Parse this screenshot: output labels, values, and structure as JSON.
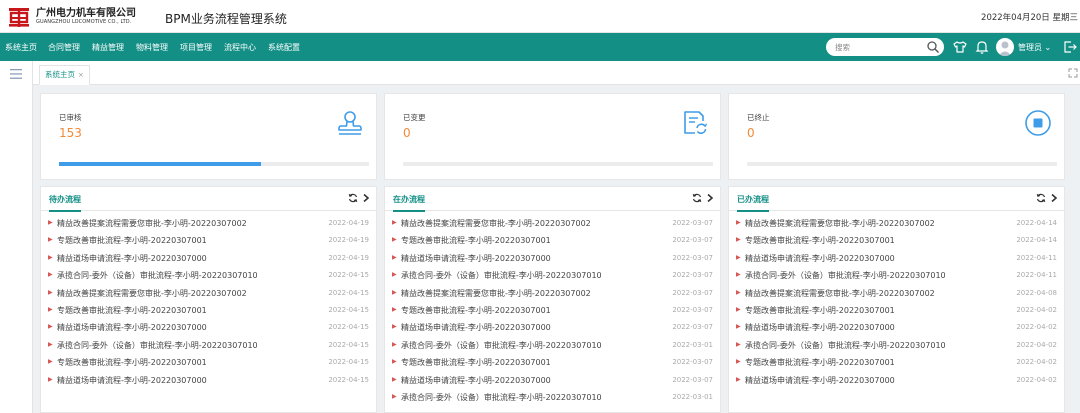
{
  "header": {
    "company_cn": "广州电力机车有限公司",
    "company_en": "GUANGZHOU LOCOMOTIVE CO., LTD.",
    "system_title": "BPM业务流程管理系统",
    "date": "2022年04月20日  星期三",
    "logo_color": "#c8161d"
  },
  "nav": {
    "items": [
      "系统主页",
      "合同管理",
      "精益管理",
      "物料管理",
      "项目管理",
      "流程中心",
      "系统配置"
    ],
    "search_placeholder": "搜索",
    "user_label": "管理员 ⌄",
    "bg_color": "#138f86"
  },
  "tabs": {
    "items": [
      {
        "label": "系统主页",
        "close": "×"
      }
    ]
  },
  "stats": [
    {
      "label": "已审核",
      "value": "153",
      "progress_fraction": 0.65,
      "icon": "stamp-icon"
    },
    {
      "label": "已变更",
      "value": "0",
      "progress_fraction": 0,
      "icon": "document-refresh-icon"
    },
    {
      "label": "已终止",
      "value": "0",
      "progress_fraction": 0,
      "icon": "stop-icon"
    }
  ],
  "panels": [
    {
      "title": "待办流程",
      "rows": [
        {
          "text": "精益改善提案流程需要您审批-李小明-20220307002",
          "date": "2022-04-19"
        },
        {
          "text": "专题改善审批流程-李小明-20220307001",
          "date": "2022-04-19"
        },
        {
          "text": "精益道场申请流程-李小明-20220307000",
          "date": "2022-04-19"
        },
        {
          "text": "承揽合同-委外（设备）审批流程-李小明-20220307010",
          "date": "2022-04-15"
        },
        {
          "text": "精益改善提案流程需要您审批-李小明-20220307002",
          "date": "2022-04-15"
        },
        {
          "text": "专题改善审批流程-李小明-20220307001",
          "date": "2022-04-15"
        },
        {
          "text": "精益道场申请流程-李小明-20220307000",
          "date": "2022-04-15"
        },
        {
          "text": "承揽合同-委外（设备）审批流程-李小明-20220307010",
          "date": "2022-04-15"
        },
        {
          "text": "专题改善审批流程-李小明-20220307001",
          "date": "2022-04-15"
        },
        {
          "text": "精益道场申请流程-李小明-20220307000",
          "date": "2022-04-15"
        }
      ]
    },
    {
      "title": "在办流程",
      "rows": [
        {
          "text": "精益改善提案流程需要您审批-李小明-20220307002",
          "date": "2022-03-07"
        },
        {
          "text": "专题改善审批流程-李小明-20220307001",
          "date": "2022-03-07"
        },
        {
          "text": "精益道场申请流程-李小明-20220307000",
          "date": "2022-03-07"
        },
        {
          "text": "承揽合同-委外（设备）审批流程-李小明-20220307010",
          "date": "2022-03-07"
        },
        {
          "text": "精益改善提案流程需要您审批-李小明-20220307002",
          "date": "2022-03-07"
        },
        {
          "text": "专题改善审批流程-李小明-20220307001",
          "date": "2022-03-07"
        },
        {
          "text": "精益道场申请流程-李小明-20220307000",
          "date": "2022-03-07"
        },
        {
          "text": "承揽合同-委外（设备）审批流程-李小明-20220307010",
          "date": "2022-03-01"
        },
        {
          "text": "专题改善审批流程-李小明-20220307001",
          "date": "2022-03-07"
        },
        {
          "text": "精益道场申请流程-李小明-20220307000",
          "date": "2022-03-07"
        },
        {
          "text": "承揽合同-委外（设备）审批流程-李小明-20220307010",
          "date": "2022-03-01"
        }
      ]
    },
    {
      "title": "已办流程",
      "rows": [
        {
          "text": "精益改善提案流程需要您审批-李小明-20220307002",
          "date": "2022-04-14"
        },
        {
          "text": "专题改善审批流程-李小明-20220307001",
          "date": "2022-04-14"
        },
        {
          "text": "精益道场申请流程-李小明-20220307000",
          "date": "2022-04-11"
        },
        {
          "text": "承揽合同-委外（设备）审批流程-李小明-20220307010",
          "date": "2022-04-11"
        },
        {
          "text": "精益改善提案流程需要您审批-李小明-20220307002",
          "date": "2022-04-08"
        },
        {
          "text": "专题改善审批流程-李小明-20220307001",
          "date": "2022-04-02"
        },
        {
          "text": "精益道场申请流程-李小明-20220307000",
          "date": "2022-04-02"
        },
        {
          "text": "承揽合同-委外（设备）审批流程-李小明-20220307010",
          "date": "2022-04-02"
        },
        {
          "text": "专题改善审批流程-李小明-20220307001",
          "date": "2022-04-02"
        },
        {
          "text": "精益道场申请流程-李小明-20220307000",
          "date": "2022-04-02"
        }
      ]
    }
  ]
}
